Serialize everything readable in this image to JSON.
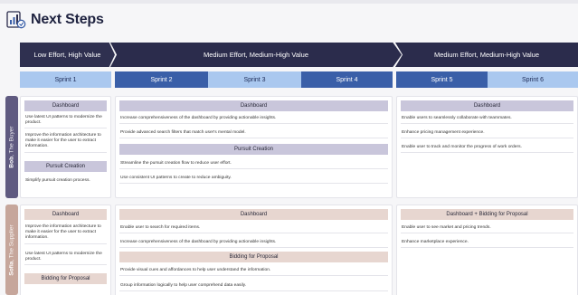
{
  "title": "Next Steps",
  "efforts": [
    "Low Effort, High Value",
    "Medium Effort, Medium-High Value",
    "Medium Effort, Medium-High Value"
  ],
  "sprints": [
    "Sprint 1",
    "Sprint 2",
    "Sprint 3",
    "Sprint 4",
    "Sprint 5",
    "Sprint 6"
  ],
  "colors": {
    "navy": "#2b2c4c",
    "sprint_light": "#aac8ef",
    "sprint_blue": "#3a5fa8",
    "bob": "#5f5a80",
    "sofia": "#c6a69b"
  },
  "personas": {
    "bob": {
      "name": "Bob",
      "role": "The Buyer",
      "col1": {
        "head": "Dashboard",
        "items": [
          "Use latest UI patterns to modernize the product.",
          "Improve the information architecture to make it easier for the user to extract information."
        ],
        "head2": "Pursuit Creation",
        "items2": [
          "Simplify pursuit creation process."
        ]
      },
      "col2": {
        "head": "Dashboard",
        "items": [
          "Increase comprehensiveness of the dashboard by providing actionable insights.",
          "Provide advanced search filters that match user's mental model."
        ],
        "head2": "Pursuit Creation",
        "items2": [
          "Streamline the pursuit creation flow to reduce user effort.",
          "Use consistent UI patterns to create to reduce ambiguity."
        ]
      },
      "col3": {
        "head": "Dashboard",
        "items": [
          "Enable users to seamlessly collaborate with teammates.",
          "Enhance pricing management experience.",
          "Enable user to track and monitor the progress of work orders."
        ]
      }
    },
    "sofia": {
      "name": "Sofia",
      "role": "The Supplier",
      "col1": {
        "head": "Dashboard",
        "items": [
          "Improve the information architecture to make it easier for the user to extract information.",
          "Use latest UI patterns to modernize the product."
        ],
        "head2": "Bidding for Proposal",
        "items2": []
      },
      "col2": {
        "head": "Dashboard",
        "items": [
          "Enable user to search for required items.",
          "Increase comprehensiveness of the dashboard by providing actionable insights."
        ],
        "head2": "Bidding for Proposal",
        "items2": [
          "Provide visual cues and affordances to help user understand the information.",
          "Group information logically to help user comprehend data easily."
        ]
      },
      "col3": {
        "head": "Dashboard + Bidding for Proposal",
        "items": [
          "Enable user to see market and pricing trends.",
          "Enhance marketplace experience."
        ]
      }
    }
  }
}
